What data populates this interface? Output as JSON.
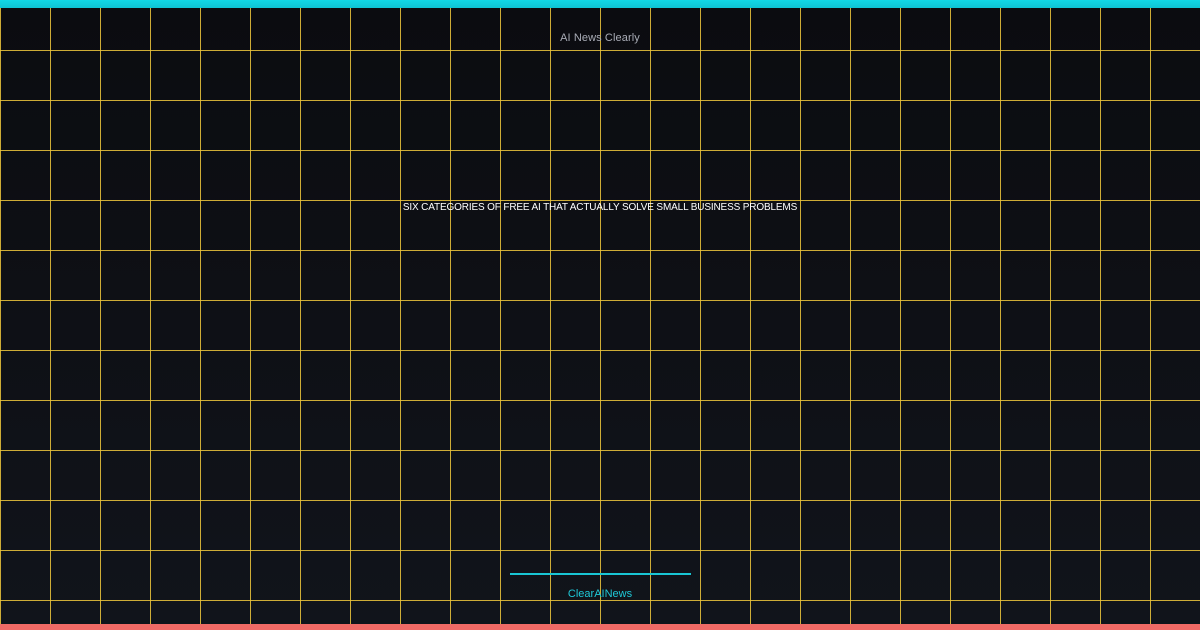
{
  "header": {
    "site_name": "AI News Clearly"
  },
  "main": {
    "headline": "SIX CATEGORIES OF FREE AI THAT ACTUALLY SOLVE SMALL BUSINESS PROBLEMS"
  },
  "footer": {
    "brand": "ClearAINews"
  },
  "colors": {
    "background": "#0d0f14",
    "grid": "#f0c83c",
    "accent_cyan": "#11d8e6",
    "accent_coral": "#f06a66",
    "headline_text": "#ffffff",
    "site_name_text": "#a9acb6"
  }
}
